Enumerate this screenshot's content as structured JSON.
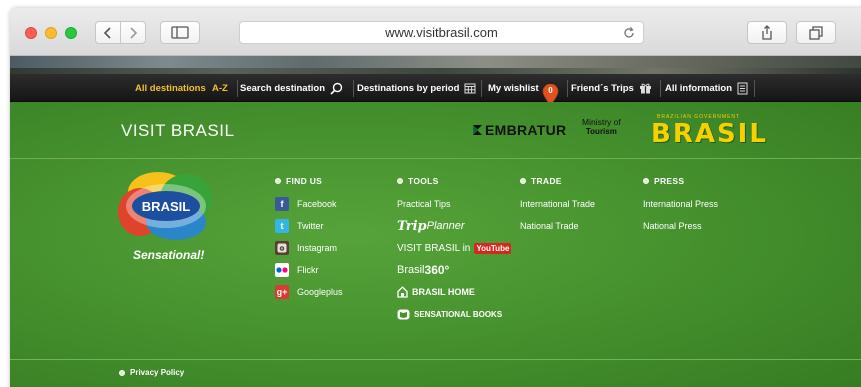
{
  "browser": {
    "url": "www.visitbrasil.com"
  },
  "nav": {
    "all_destinations": "All destinations",
    "a_z": "A-Z",
    "search_destination": "Search destination",
    "destinations_by_period": "Destinations by period",
    "my_wishlist": "My wishlist",
    "wishlist_count": "0",
    "friends_trips": "Friend´s Trips",
    "all_information": "All information"
  },
  "brand": {
    "visit_brasil": "VISIT BRASIL",
    "embratur": "EMBRATUR",
    "ministry_line1": "Ministry of",
    "ministry_line2": "Tourism",
    "gov_small": "BRAZILIAN GOVERNMENT",
    "gov_big": "BRASIL",
    "badge_text": "BRASIL",
    "sensational": "Sensational!"
  },
  "columns": {
    "find_us": {
      "heading": "FIND US",
      "items": [
        "Facebook",
        "Twitter",
        "Instagram",
        "Flickr",
        "Googleplus"
      ]
    },
    "tools": {
      "heading": "TOOLS",
      "practical_tips": "Practical Tips",
      "trip_planner_a": "Trip",
      "trip_planner_b": "Planner",
      "visit_brasil_in": "VISIT BRASIL in",
      "youtube": "YouTube",
      "brasil360_a": "Brasil",
      "brasil360_b": "360°",
      "brasil_home": "BRASIL HOME",
      "sensational_books": "SENSATIONAL BOOKS"
    },
    "trade": {
      "heading": "TRADE",
      "items": [
        "International Trade",
        "National Trade"
      ]
    },
    "press": {
      "heading": "PRESS",
      "items": [
        "International Press",
        "National Press"
      ]
    }
  },
  "footer": {
    "privacy_policy": "Privacy Policy"
  },
  "colors": {
    "accent_yellow": "#f2c12e",
    "page_green": "#46922e",
    "navbar_dark": "#1d1d1d"
  }
}
